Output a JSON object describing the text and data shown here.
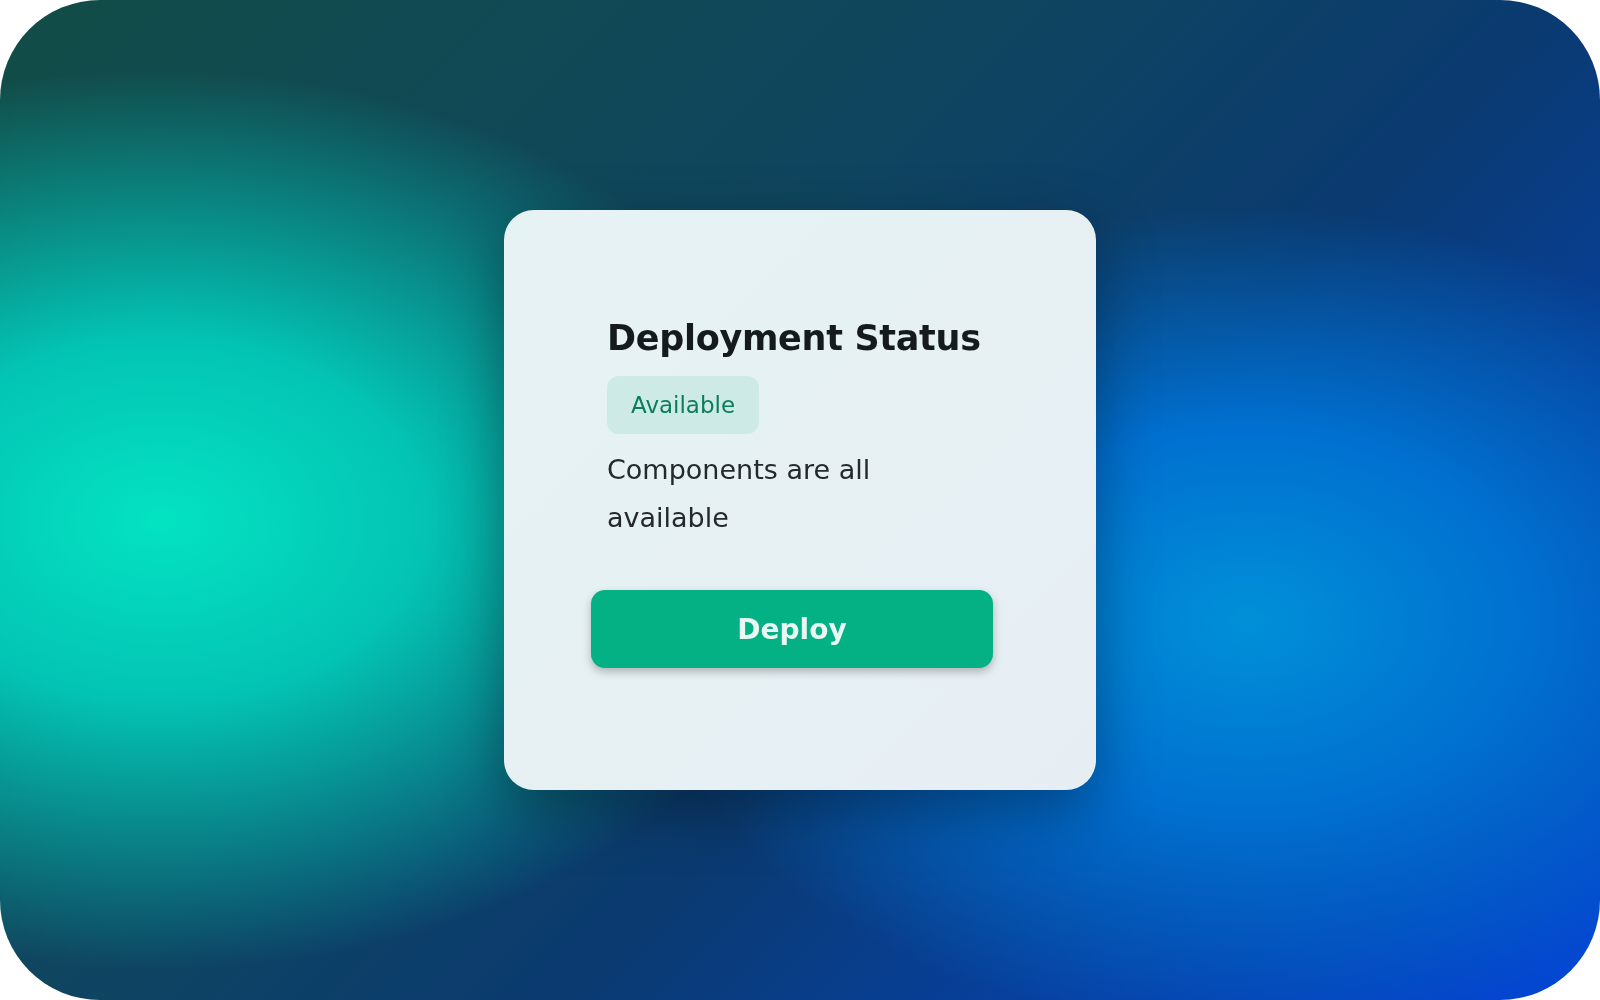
{
  "card": {
    "title": "Deployment Status",
    "status": {
      "label": "Available"
    },
    "description": "Components are all available",
    "button": {
      "label": "Deploy"
    }
  }
}
